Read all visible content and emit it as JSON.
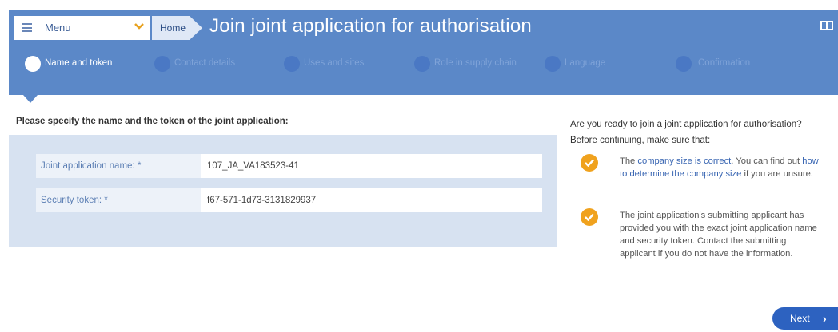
{
  "header": {
    "menu_label": "Menu",
    "home_label": "Home",
    "title": "Join joint application for authorisation"
  },
  "steps": [
    {
      "label": "Name and token",
      "active": true
    },
    {
      "label": "Contact details",
      "active": false
    },
    {
      "label": "Uses and sites",
      "active": false
    },
    {
      "label": "Role in supply chain",
      "active": false
    },
    {
      "label": "Language",
      "active": false
    },
    {
      "label": "Confirmation",
      "active": false
    }
  ],
  "form": {
    "instruction": "Please specify the name and the token of the joint application:",
    "fields": [
      {
        "label": "Joint application name: *",
        "value": "107_JA_VA183523-41"
      },
      {
        "label": "Security token: *",
        "value": "f67-571-1d73-3131829937"
      }
    ]
  },
  "info": {
    "question_line1": "Are you ready to join a joint application for authorisation?",
    "question_line2": "Before continuing, make sure that:",
    "item1": {
      "t1": "The ",
      "link1": "company size is correct",
      "t2": ". You can find out ",
      "link2": "how to determine the company size",
      "t3": " if you are unsure."
    },
    "item2": {
      "text": "The joint application's submitting applicant has provided you with the exact joint application name and security token. Contact the submitting applicant if you do not have the information."
    }
  },
  "actions": {
    "next_label": "Next",
    "next_arrow": "›"
  },
  "colors": {
    "header_blue": "#5b88c8",
    "panel_blue": "#d7e2f1",
    "check_orange": "#f0a21e",
    "button_blue": "#2d62c0",
    "link_blue": "#3865b2"
  }
}
